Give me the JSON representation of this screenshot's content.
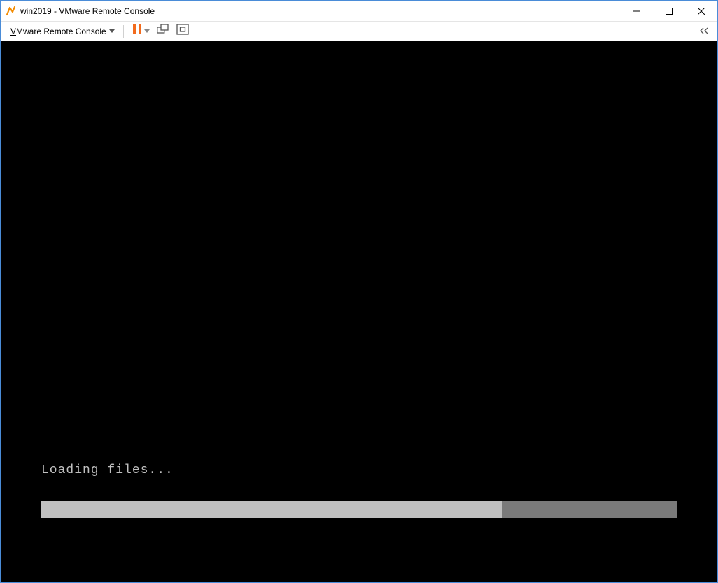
{
  "window": {
    "title": "win2019 - VMware Remote Console"
  },
  "toolbar": {
    "menu_label_prefix": "V",
    "menu_label_rest": "Mware Remote Console"
  },
  "console": {
    "status_text": "Loading files...",
    "progress_percent": 72.5
  }
}
